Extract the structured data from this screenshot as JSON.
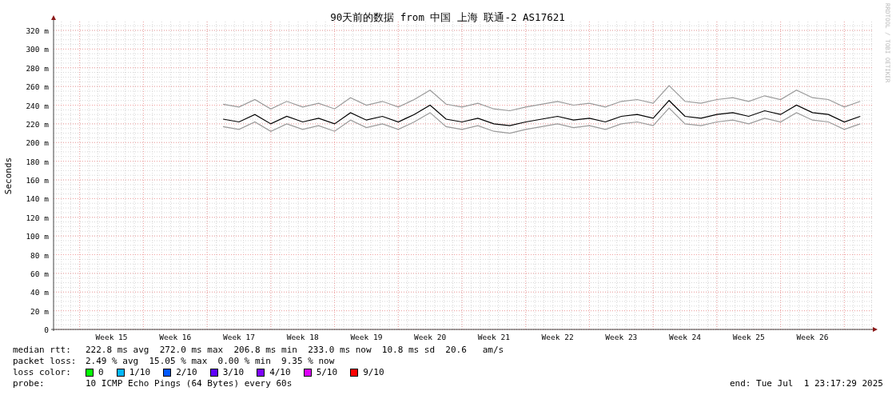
{
  "chart": {
    "credit": "RRDTOOL / TOBI OETIKER",
    "chart_data": {
      "type": "line",
      "title": "90天前的数据 from 中国 上海 联通-2 AS17621",
      "ylabel": "Seconds",
      "grid": true,
      "ylim": [
        0,
        329
      ],
      "categories": [
        null,
        null,
        "Week 15",
        null,
        null,
        null,
        "Week 16",
        null,
        null,
        null,
        "Week 17",
        null,
        null,
        null,
        "Week 18",
        null,
        null,
        null,
        "Week 19",
        null,
        null,
        null,
        "Week 20",
        null,
        null,
        null,
        "Week 21",
        null,
        null,
        null,
        "Week 22",
        null,
        null,
        null,
        "Week 23",
        null,
        null,
        null,
        "Week 24",
        null,
        null,
        null,
        "Week 25",
        null,
        null,
        null,
        "Week 26",
        null,
        null,
        null
      ],
      "yticks": [
        {
          "value": 0,
          "label": "0"
        },
        {
          "value": 20,
          "label": "20 m"
        },
        {
          "value": 40,
          "label": "40 m"
        },
        {
          "value": 60,
          "label": "60 m"
        },
        {
          "value": 80,
          "label": "80 m"
        },
        {
          "value": 100,
          "label": "100 m"
        },
        {
          "value": 120,
          "label": "120 m"
        },
        {
          "value": 140,
          "label": "140 m"
        },
        {
          "value": 160,
          "label": "160 m"
        },
        {
          "value": 180,
          "label": "180 m"
        },
        {
          "value": 200,
          "label": "200 m"
        },
        {
          "value": 220,
          "label": "220 m"
        },
        {
          "value": 240,
          "label": "240 m"
        },
        {
          "value": 260,
          "label": "260 m"
        },
        {
          "value": 280,
          "label": "280 m"
        },
        {
          "value": 300,
          "label": "300 m"
        },
        {
          "value": 320,
          "label": "320 m"
        }
      ],
      "series": [
        {
          "color": "#9a9a9a",
          "values": [
            null,
            null,
            null,
            null,
            null,
            null,
            null,
            null,
            null,
            217,
            214,
            222,
            212,
            220,
            214,
            218,
            212,
            224,
            216,
            220,
            214,
            222,
            232,
            217,
            214,
            218,
            212,
            210,
            214,
            217,
            220,
            216,
            218,
            214,
            220,
            222,
            218,
            237,
            220,
            218,
            222,
            224,
            220,
            226,
            222,
            232,
            224,
            222,
            214,
            220
          ]
        },
        {
          "color": "#9a9a9a",
          "values": [
            null,
            null,
            null,
            null,
            null,
            null,
            null,
            null,
            null,
            241,
            238,
            246,
            236,
            244,
            238,
            242,
            236,
            248,
            240,
            244,
            238,
            246,
            256,
            241,
            238,
            242,
            236,
            234,
            238,
            241,
            244,
            240,
            242,
            238,
            244,
            246,
            242,
            261,
            244,
            242,
            246,
            248,
            244,
            250,
            246,
            256,
            248,
            246,
            238,
            244
          ]
        },
        {
          "color": "#000000",
          "values": [
            null,
            null,
            null,
            null,
            null,
            null,
            null,
            null,
            null,
            225,
            222,
            230,
            220,
            228,
            222,
            226,
            220,
            232,
            224,
            228,
            222,
            230,
            240,
            225,
            222,
            226,
            220,
            218,
            222,
            225,
            228,
            224,
            226,
            222,
            228,
            230,
            226,
            245,
            228,
            226,
            230,
            232,
            228,
            234,
            230,
            240,
            232,
            230,
            222,
            228
          ]
        }
      ]
    }
  },
  "legend_rows": [
    {
      "kind": "text",
      "label": "median rtt:",
      "text": "222.8 ms avg  272.0 ms max  206.8 ms min  233.0 ms now  10.8 ms sd  20.6   am/s"
    },
    {
      "kind": "text",
      "label": "packet loss:",
      "text": "2.49 % avg  15.05 % max  0.00 % min  9.35 % now"
    },
    {
      "kind": "swatches",
      "label": "loss color:",
      "items": [
        {
          "label": "0",
          "color": "#00ff00"
        },
        {
          "label": "1/10",
          "color": "#00b8ff"
        },
        {
          "label": "2/10",
          "color": "#0059ff"
        },
        {
          "label": "3/10",
          "color": "#5e00ff"
        },
        {
          "label": "4/10",
          "color": "#7e00ff"
        },
        {
          "label": "5/10",
          "color": "#dd00ff"
        },
        {
          "label": "9/10",
          "color": "#ff0000"
        }
      ]
    },
    {
      "kind": "probe",
      "label": "probe:",
      "text": "10 ICMP Echo Pings (64 Bytes) every 60s",
      "end": "end: Tue Jul  1 23:17:29 2025"
    }
  ]
}
